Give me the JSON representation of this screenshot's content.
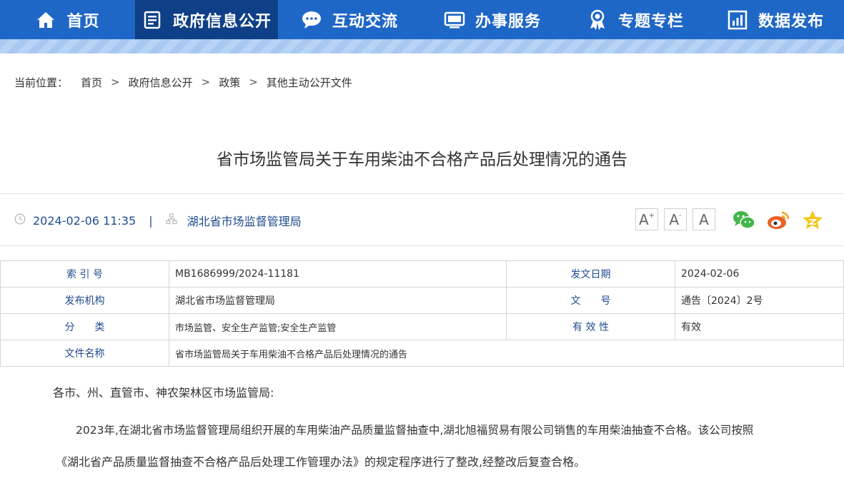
{
  "nav": {
    "items": [
      {
        "label": "首页",
        "icon": "home-icon"
      },
      {
        "label": "政府信息公开",
        "icon": "document-list-icon"
      },
      {
        "label": "互动交流",
        "icon": "chat-bubble-icon"
      },
      {
        "label": "办事服务",
        "icon": "monitor-icon"
      },
      {
        "label": "专题专栏",
        "icon": "award-ribbon-icon"
      },
      {
        "label": "数据发布",
        "icon": "bar-chart-icon"
      }
    ],
    "active_index": 1
  },
  "breadcrumb": {
    "lead": "当前位置：",
    "items": [
      "首页",
      "政府信息公开",
      "政策",
      "其他主动公开文件"
    ],
    "separator": ">"
  },
  "article": {
    "title": "省市场监管局关于车用柴油不合格产品后处理情况的通告",
    "datetime": "2024-02-06 11:35",
    "source": "湖北省市场监督管理局"
  },
  "tools": {
    "font_increase": "A",
    "font_decrease": "A",
    "font_reset": "A",
    "share": [
      "wechat-icon",
      "weibo-icon",
      "favorite-star-icon"
    ]
  },
  "info": {
    "index_label": "索 引 号",
    "index_value": "MB1686999/2024-11181",
    "date_label": "发文日期",
    "date_value": "2024-02-06",
    "publisher_label": "发布机构",
    "publisher_value": "湖北省市场监督管理局",
    "docno_label": "文　　号",
    "docno_value": "通告〔2024〕2号",
    "category_label": "分　　类",
    "category_value": "市场监管、安全生产监管;安全生产监管",
    "validity_label": "有 效 性",
    "validity_value": "有效",
    "filename_label": "文件名称",
    "filename_value": "省市场监管局关于车用柴油不合格产品后处理情况的通告"
  },
  "body": {
    "salutation": "各市、州、直管市、神农架林区市场监管局:",
    "para1_line1": "2023年,在湖北省市场监督管理局组织开展的车用柴油产品质量监督抽查中,湖北旭福贸易有限公司销售的车用柴油抽查不合格。该公司按照",
    "para1_line2": "《湖北省产品质量监督抽查不合格产品后处理工作管理办法》的规定程序进行了整改,经整改后复查合格。"
  },
  "colors": {
    "nav_bg": "#1f67c7",
    "nav_active": "#0f3f86",
    "link": "#1f4b8f"
  }
}
